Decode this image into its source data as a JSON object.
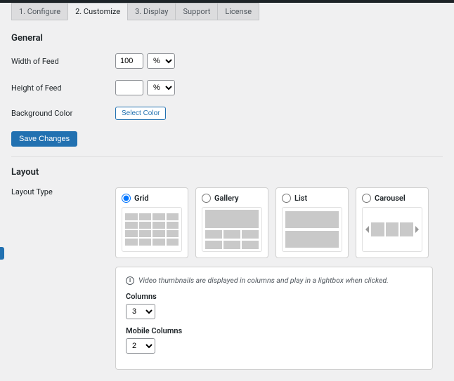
{
  "tabs": {
    "configure": "1. Configure",
    "customize": "2. Customize",
    "display": "3. Display",
    "support": "Support",
    "license": "License"
  },
  "general": {
    "title": "General",
    "width_label": "Width of Feed",
    "width_value": "100",
    "width_unit": "%",
    "height_label": "Height of Feed",
    "height_value": "",
    "height_unit": "%",
    "bgcolor_label": "Background Color",
    "select_color_btn": "Select Color",
    "save_btn": "Save Changes"
  },
  "layout": {
    "title": "Layout",
    "type_label": "Layout Type",
    "options": {
      "grid": "Grid",
      "gallery": "Gallery",
      "list": "List",
      "carousel": "Carousel"
    },
    "selected": "grid",
    "note": "Video thumbnails are displayed in columns and play in a lightbox when clicked.",
    "columns_label": "Columns",
    "columns_value": "3",
    "mobile_columns_label": "Mobile Columns",
    "mobile_columns_value": "2"
  }
}
